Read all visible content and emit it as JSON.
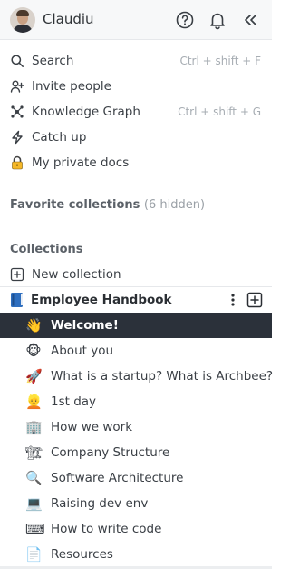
{
  "user": {
    "name": "Claudiu"
  },
  "header_icons": [
    "help-icon",
    "bell-icon",
    "collapse-sidebar-icon"
  ],
  "nav": [
    {
      "id": "search",
      "label": "Search",
      "shortcut": "Ctrl + shift + F",
      "icon": "search-icon"
    },
    {
      "id": "invite",
      "label": "Invite people",
      "icon": "add-user-icon"
    },
    {
      "id": "graph",
      "label": "Knowledge Graph",
      "shortcut": "Ctrl + shift + G",
      "icon": "graph-icon"
    },
    {
      "id": "catchup",
      "label": "Catch up",
      "icon": "lightning-icon"
    },
    {
      "id": "private",
      "label": "My private docs",
      "icon": "lock-icon"
    }
  ],
  "favorites": {
    "title": "Favorite collections",
    "hidden": "(6 hidden)"
  },
  "collections": {
    "title": "Collections",
    "new_label": "New collection",
    "current": {
      "label": "Employee Handbook",
      "icon": "book-icon"
    }
  },
  "pages": [
    {
      "label": "Welcome!",
      "emoji": "👋",
      "active": true
    },
    {
      "label": "About you",
      "emoji": "🐵"
    },
    {
      "label": "What is a startup? What is Archbee?",
      "emoji": "🚀"
    },
    {
      "label": "1st day",
      "emoji": "👱"
    },
    {
      "label": "How we work",
      "emoji": "🏢"
    },
    {
      "label": "Company Structure",
      "emoji": "🏗"
    },
    {
      "label": "Software Architecture",
      "emoji": "🔍"
    },
    {
      "label": "Raising dev env",
      "emoji": "💻"
    },
    {
      "label": "How to write code",
      "emoji": "⌨"
    },
    {
      "label": "Resources",
      "emoji": "📄"
    }
  ],
  "colors": {
    "active_bg": "#2b313a",
    "header_bg": "#f7f8f9"
  }
}
